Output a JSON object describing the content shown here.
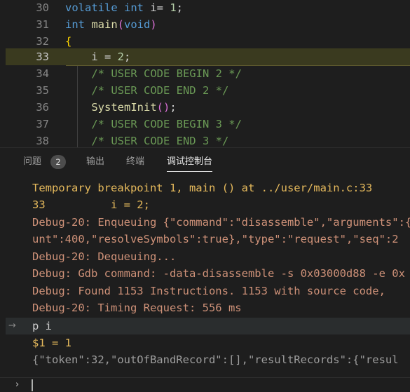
{
  "editor": {
    "lines": [
      {
        "num": "30",
        "tokens": [
          {
            "t": "volatile",
            "c": "kw"
          },
          {
            "t": " ",
            "c": ""
          },
          {
            "t": "int",
            "c": "kw"
          },
          {
            "t": " i= ",
            "c": ""
          },
          {
            "t": "1",
            "c": "num"
          },
          {
            "t": ";",
            "c": ""
          }
        ]
      },
      {
        "num": "31",
        "tokens": [
          {
            "t": "int",
            "c": "kw"
          },
          {
            "t": " ",
            "c": ""
          },
          {
            "t": "main",
            "c": "fn"
          },
          {
            "t": "(",
            "c": "br2"
          },
          {
            "t": "void",
            "c": "kw"
          },
          {
            "t": ")",
            "c": "br2"
          }
        ]
      },
      {
        "num": "32",
        "tokens": [
          {
            "t": "{",
            "c": "br1"
          }
        ]
      },
      {
        "num": "33",
        "tokens": [
          {
            "t": "    i = ",
            "c": ""
          },
          {
            "t": "2",
            "c": "num"
          },
          {
            "t": ";",
            "c": ""
          }
        ]
      },
      {
        "num": "34",
        "tokens": [
          {
            "t": "    /* USER CODE BEGIN 2 */",
            "c": "cm"
          }
        ]
      },
      {
        "num": "35",
        "tokens": [
          {
            "t": "    /* USER CODE END 2 */",
            "c": "cm"
          }
        ]
      },
      {
        "num": "36",
        "tokens": [
          {
            "t": "    ",
            "c": ""
          },
          {
            "t": "SystemInit",
            "c": "fn"
          },
          {
            "t": "()",
            "c": "br2"
          },
          {
            "t": ";",
            "c": ""
          }
        ]
      },
      {
        "num": "37",
        "tokens": [
          {
            "t": "    /* USER CODE BEGIN 3 */",
            "c": "cm"
          }
        ]
      },
      {
        "num": "38",
        "tokens": [
          {
            "t": "    /* USER CODE END 3 */",
            "c": "cm"
          }
        ]
      }
    ],
    "current_line": "33",
    "breakpoint_icon": "current-breakpoint-arrow-icon"
  },
  "panel": {
    "tabs": [
      {
        "label": "问题",
        "badge": "2"
      },
      {
        "label": "输出"
      },
      {
        "label": "终端"
      },
      {
        "label": "调试控制台",
        "active": true
      }
    ],
    "console": [
      {
        "text": "Temporary breakpoint 1, main () at ../user/main.c:33",
        "color": "yellow"
      },
      {
        "text": "33          i = 2;",
        "color": "yellow"
      },
      {
        "text": "Debug-20: Enqueuing {\"command\":\"disassemble\",\"arguments\":{",
        "color": "orange"
      },
      {
        "text": "unt\":400,\"resolveSymbols\":true},\"type\":\"request\",\"seq\":2",
        "color": "orange"
      },
      {
        "text": "Debug-20: Dequeuing...",
        "color": "orange"
      },
      {
        "text": "Debug: Gdb command: -data-disassemble -s 0x03000d88 -e 0x",
        "color": "orange"
      },
      {
        "text": "Debug: Found 1153 Instructions. 1153 with source code,",
        "color": "orange"
      },
      {
        "text": "Debug-20: Timing Request: 556 ms",
        "color": "orange"
      },
      {
        "text": "p i",
        "color": "white",
        "echo": true
      },
      {
        "text": "$1 = 1",
        "color": "yellow"
      },
      {
        "text": "{\"token\":32,\"outOfBandRecord\":[],\"resultRecords\":{\"resul",
        "color": "grey"
      }
    ],
    "echo_arrow": "→",
    "repl_prompt": "›",
    "repl_value": ""
  },
  "colors": {
    "background": "#1e1e1e",
    "keyword": "#569cd6",
    "function": "#dcdcaa",
    "comment": "#6a9955",
    "number": "#b5cea8",
    "debug_output": "#ce9178",
    "gdb_output": "#e5b95c",
    "breakpoint": "#ffcc00"
  }
}
